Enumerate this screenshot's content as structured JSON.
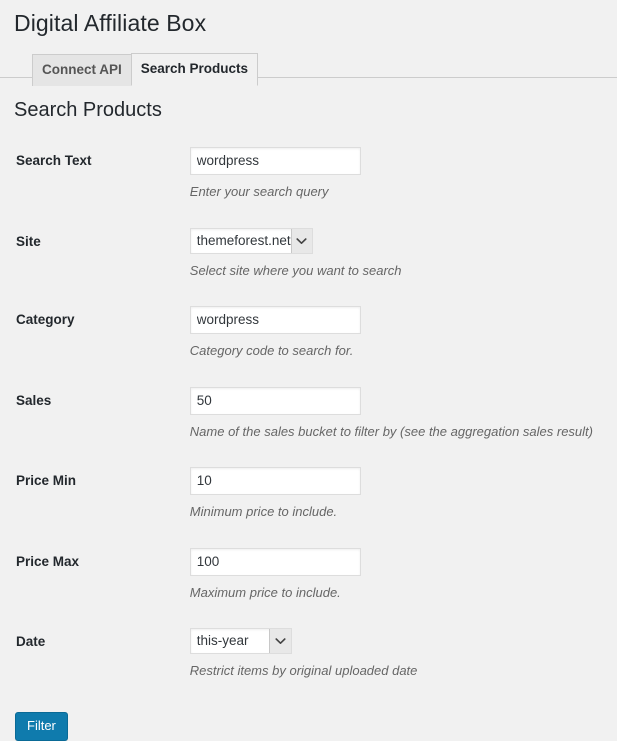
{
  "page": {
    "title": "Digital Affiliate Box",
    "section_heading": "Search Products"
  },
  "tabs": [
    {
      "label": "Connect API",
      "active": false
    },
    {
      "label": "Search Products",
      "active": true
    }
  ],
  "form": {
    "fields": [
      {
        "label": "Search Text",
        "type": "text",
        "value": "wordpress",
        "description": "Enter your search query"
      },
      {
        "label": "Site",
        "type": "select",
        "value": "themeforest.net",
        "description": "Select site where you want to search"
      },
      {
        "label": "Category",
        "type": "text",
        "value": "wordpress",
        "description": "Category code to search for."
      },
      {
        "label": "Sales",
        "type": "text",
        "value": "50",
        "description": "Name of the sales bucket to filter by (see the aggregation sales result)"
      },
      {
        "label": "Price Min",
        "type": "text",
        "value": "10",
        "description": "Minimum price to include."
      },
      {
        "label": "Price Max",
        "type": "text",
        "value": "100",
        "description": "Maximum price to include."
      },
      {
        "label": "Date",
        "type": "select",
        "value": "this-year",
        "description": "Restrict items by original uploaded date"
      }
    ],
    "submit_label": "Filter"
  },
  "colors": {
    "page_background": "#f1f1f1",
    "heading_text": "#23282d",
    "description_text": "#666666",
    "primary_button_background": "#0f7bad",
    "primary_button_border": "#0a6a96",
    "input_border": "#dddddd",
    "tab_border": "#cccccc",
    "inactive_tab_background": "#e5e5e5"
  }
}
